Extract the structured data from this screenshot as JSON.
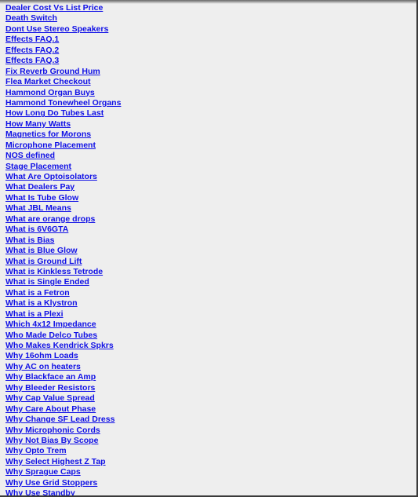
{
  "page": {
    "background_color": "#eeeeee",
    "link_color": "#1010e6"
  },
  "links": [
    "Dealer Cost Vs List Price",
    "Death Switch",
    "Dont Use Stereo Speakers",
    "Effects FAQ.1",
    "Effects FAQ.2",
    "Effects FAQ.3",
    "Fix Reverb Ground Hum",
    "Flea Market Checkout",
    "Hammond Organ Buys",
    "Hammond Tonewheel Organs",
    "How Long Do Tubes Last",
    "How Many Watts",
    "Magnetics for Morons",
    "Microphone Placement",
    "NOS defined",
    "Stage Placement",
    "What Are Optoisolators",
    "What Dealers Pay",
    "What Is Tube Glow",
    "What JBL Means",
    "What are orange drops",
    "What is 6V6GTA",
    "What is Bias",
    "What is Blue Glow",
    "What is Ground Lift",
    "What is Kinkless Tetrode",
    "What is Single Ended",
    "What is a Fetron",
    "What is a Klystron",
    "What is a Plexi",
    "Which 4x12 Impedance",
    "Who Made Delco Tubes",
    "Who Makes Kendrick Spkrs",
    "Why 16ohm Loads",
    "Why AC on heaters",
    "Why Blackface an Amp",
    "Why Bleeder Resistors",
    "Why Cap Value Spread",
    "Why Care About Phase",
    "Why Change SF Lead Dress",
    "Why Microphonic Cords",
    "Why Not Bias By Scope",
    "Why Opto Trem",
    "Why Select Highest Z Tap",
    "Why Sprague Caps",
    "Why Use Grid Stoppers",
    "Why Use Standby"
  ]
}
